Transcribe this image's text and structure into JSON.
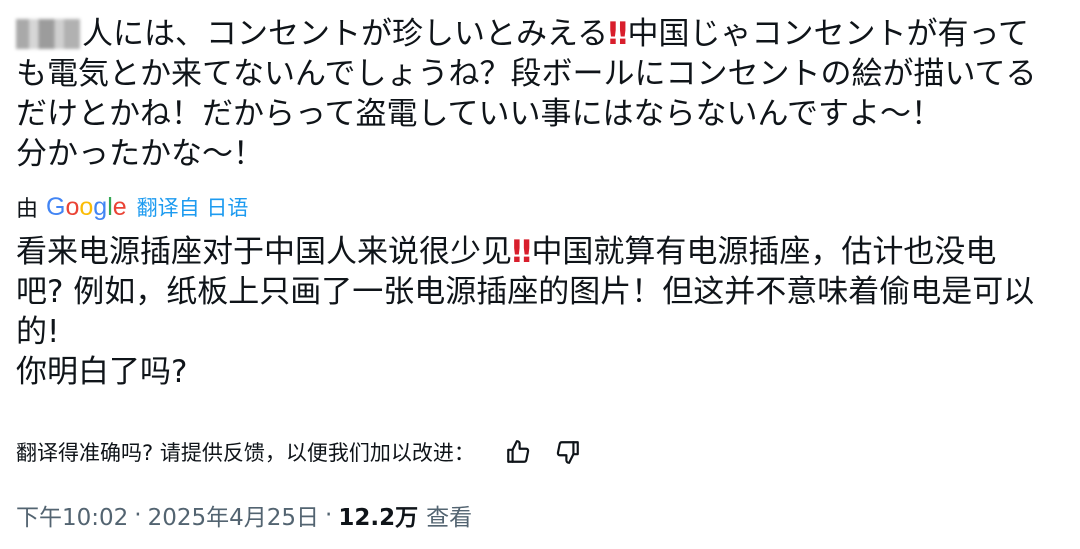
{
  "original_text": {
    "line1_before": "人には、コンセントが珍しいとみえる",
    "line1_bang": "‼",
    "line1_after": "中国じゃコンセントが有って",
    "line2": "も電気とか来てないんでしょうね？段ボールにコンセントの絵が描いてる",
    "line3": "だけとかね！だからって盗電していい事にはならないんですよ〜！",
    "line4": "分かったかな〜！"
  },
  "translation_bar": {
    "by_label": "由",
    "google_letters": [
      "G",
      "o",
      "o",
      "g",
      "l",
      "e"
    ],
    "translated_from": "翻译自 日语"
  },
  "translated_text": {
    "line1_before": "看来电源插座对于中国人来说很少见",
    "line1_bang": "‼",
    "line1_after": "中国就算有电源插座，估计也没电",
    "line2": "吧? 例如，纸板上只画了一张电源插座的图片！但这并不意味着偷电是可以",
    "line3": "的!",
    "line4": "你明白了吗?"
  },
  "feedback": {
    "prompt": "翻译得准确吗? 请提供反馈，以便我们加以改进："
  },
  "meta": {
    "time": "下午10:02",
    "date": "2025年4月25日",
    "dot": "·",
    "views_count": "12.2万",
    "views_label": "查看"
  },
  "colors": {
    "text": "#0f1419",
    "muted": "#536471",
    "link": "#1d9bf0",
    "bang": "#d81e2c"
  }
}
